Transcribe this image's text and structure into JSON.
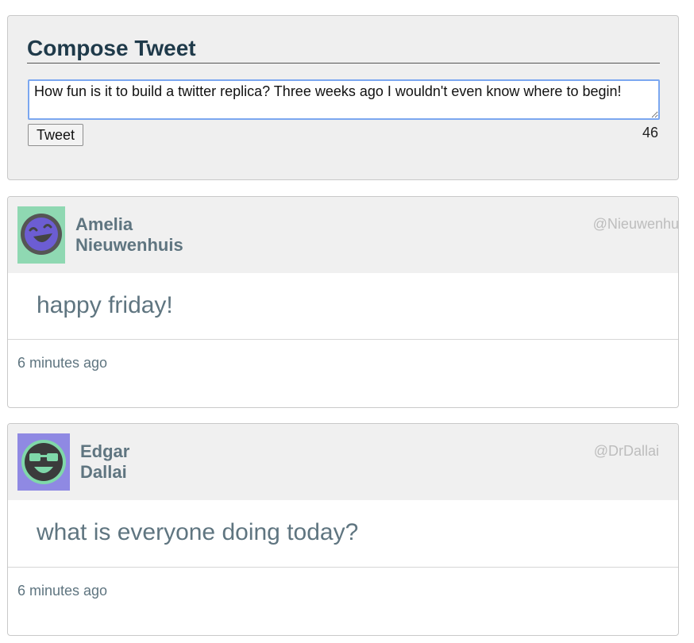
{
  "compose": {
    "title": "Compose Tweet",
    "text": "How fun is it to build a twitter replica? Three weeks ago I wouldn't even know where to begin!",
    "button_label": "Tweet",
    "char_count": "46"
  },
  "tweets": [
    {
      "name_first": "Amelia",
      "name_last": "Nieuwenhuis",
      "handle": "@Nieuwenhuis",
      "text": "happy friday!",
      "time": "6 minutes ago",
      "avatar_bg": "#8fd8b2",
      "avatar_face": "#6c5dd3",
      "avatar_icon": "laughing-face-icon"
    },
    {
      "name_first": "Edgar",
      "name_last": "Dallai",
      "handle": "@DrDallai",
      "text": "what is everyone doing today?",
      "time": "6 minutes ago",
      "avatar_bg": "#8f89e3",
      "avatar_face": "#7fd8a9",
      "avatar_icon": "sunglasses-face-icon"
    }
  ]
}
